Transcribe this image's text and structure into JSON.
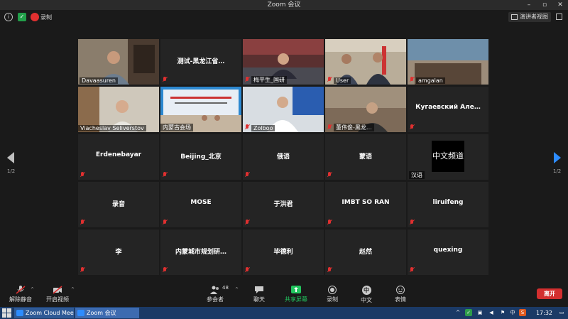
{
  "window": {
    "title": "Zoom 会议"
  },
  "topbar": {
    "record_label": "录制",
    "view_button": "演讲者视图"
  },
  "tiles": [
    {
      "name": "Davaasuren",
      "kind": "video",
      "active": true
    },
    {
      "name": "测试-黑龙江省…",
      "kind": "name"
    },
    {
      "name": "梅平生_国研",
      "kind": "video"
    },
    {
      "name": "User",
      "kind": "video"
    },
    {
      "name": "amgalan",
      "kind": "video"
    },
    {
      "name": "Viacheslav Seliverstov",
      "kind": "video"
    },
    {
      "name": "内蒙古会场",
      "kind": "video"
    },
    {
      "name": "Zolboo",
      "kind": "video"
    },
    {
      "name": "董伟俊-黑龙…",
      "kind": "video"
    },
    {
      "name": "Кугаевский Але…",
      "kind": "name"
    },
    {
      "name": "Erdenebayar",
      "kind": "name"
    },
    {
      "name": "Beijing_北京",
      "kind": "name"
    },
    {
      "name": "俄语",
      "kind": "name"
    },
    {
      "name": "蒙语",
      "kind": "name"
    },
    {
      "name": "汉语",
      "kind": "caption",
      "caption": "中文频道"
    },
    {
      "name": "录音",
      "kind": "name"
    },
    {
      "name": "MOSE",
      "kind": "name"
    },
    {
      "name": "于洪君",
      "kind": "name"
    },
    {
      "name": "IMBT SO RAN",
      "kind": "name"
    },
    {
      "name": "liruifeng",
      "kind": "name"
    },
    {
      "name": "李",
      "kind": "name"
    },
    {
      "name": "内蒙城市规划研…",
      "kind": "name"
    },
    {
      "name": "毕德利",
      "kind": "name"
    },
    {
      "name": "赵然",
      "kind": "name"
    },
    {
      "name": "quexing",
      "kind": "name"
    }
  ],
  "pager": {
    "left": "1/2",
    "right": "1/2"
  },
  "bottombar": {
    "unmute": "解除静音",
    "start_video": "开启视频",
    "participants": "参会者",
    "participants_count": "48",
    "chat": "聊天",
    "share": "共享屏幕",
    "record": "录制",
    "interpretation": "中文",
    "interpretation_icon_text": "中",
    "reactions": "表情",
    "leave": "离开"
  },
  "taskbar": {
    "items": [
      "Zoom Cloud Meeti...",
      "Zoom 会议"
    ],
    "clock": "17:32",
    "ime": "中",
    "sogou": "S"
  },
  "colors": {
    "active_border": "#c7d93d",
    "share_green": "#22c55e",
    "leave_red": "#d32f2f",
    "mute_red": "#e03030"
  }
}
